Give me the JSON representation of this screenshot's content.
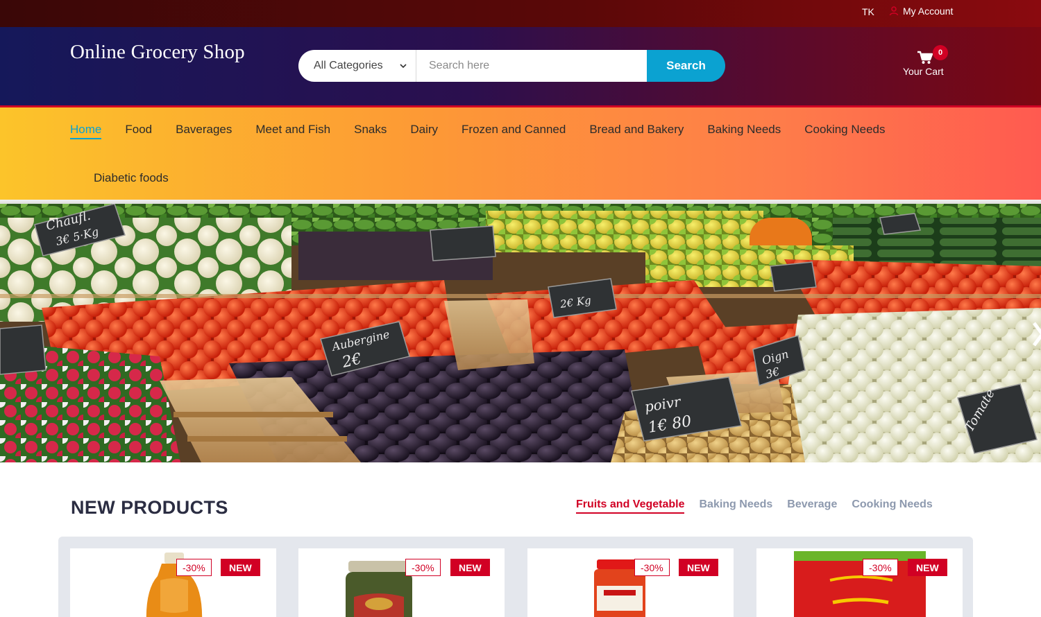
{
  "topbar": {
    "currency": "TK",
    "account_label": "My Account"
  },
  "header": {
    "logo": "Online Grocery Shop",
    "category_select": "All Categories",
    "search_placeholder": "Search here",
    "search_button": "Search",
    "cart_count": "0",
    "cart_label": "Your Cart"
  },
  "nav": {
    "items": [
      {
        "label": "Home",
        "active": true
      },
      {
        "label": "Food"
      },
      {
        "label": "Baverages"
      },
      {
        "label": "Meet and Fish"
      },
      {
        "label": "Snaks"
      },
      {
        "label": "Dairy"
      },
      {
        "label": "Frozen and Canned"
      },
      {
        "label": "Bread and Bakery"
      },
      {
        "label": "Baking Needs"
      },
      {
        "label": "Cooking Needs"
      },
      {
        "label": "Diabetic foods"
      }
    ]
  },
  "products": {
    "title": "NEW PRODUCTS",
    "tabs": [
      {
        "label": "Fruits and Vegetable",
        "active": true
      },
      {
        "label": "Baking Needs"
      },
      {
        "label": "Beverage"
      },
      {
        "label": "Cooking Needs"
      }
    ],
    "cards": [
      {
        "sale": "-30%",
        "badge": "NEW"
      },
      {
        "sale": "-30%",
        "badge": "NEW"
      },
      {
        "sale": "-30%",
        "badge": "NEW"
      },
      {
        "sale": "-30%",
        "badge": "NEW"
      }
    ]
  },
  "colors": {
    "primary_red": "#d10024",
    "search_blue": "#0ba2d1",
    "heading_navy": "#2b2d42",
    "tab_gray": "#8d99ae"
  },
  "icons": {
    "account": "user-icon",
    "cart": "cart-icon",
    "dropdown": "chevron-down-icon",
    "slider_next": "chevron-right-icon"
  }
}
